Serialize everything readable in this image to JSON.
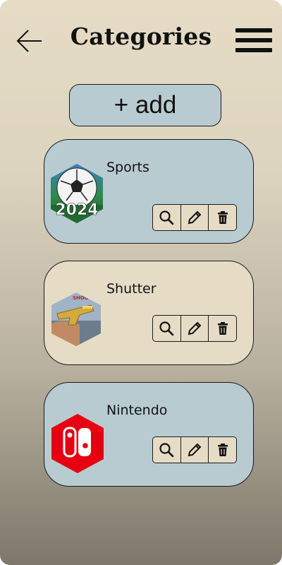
{
  "header": {
    "title": "Categories",
    "back_icon": "arrow-left-icon",
    "menu_icon": "hamburger-menu-icon"
  },
  "add_button": {
    "label": "+ add"
  },
  "categories": [
    {
      "name": "Sports",
      "image": "soccer-ball-2024-logo",
      "image_text": "2024",
      "card_color": "#b8cbd1"
    },
    {
      "name": "Shutter",
      "image": "golden-gun-shooter-image",
      "card_color": "#e6dcc6"
    },
    {
      "name": "Nintendo",
      "image": "nintendo-switch-logo",
      "card_color": "#b8cbd1"
    }
  ],
  "card_actions": [
    "search-icon",
    "pencil-icon",
    "trash-icon"
  ],
  "colors": {
    "background_top": "#e6dcc6",
    "background_bottom": "#7d786b",
    "card_blue": "#b8cbd1",
    "card_cream": "#e6dcc6",
    "nintendo_red": "#e60012"
  }
}
